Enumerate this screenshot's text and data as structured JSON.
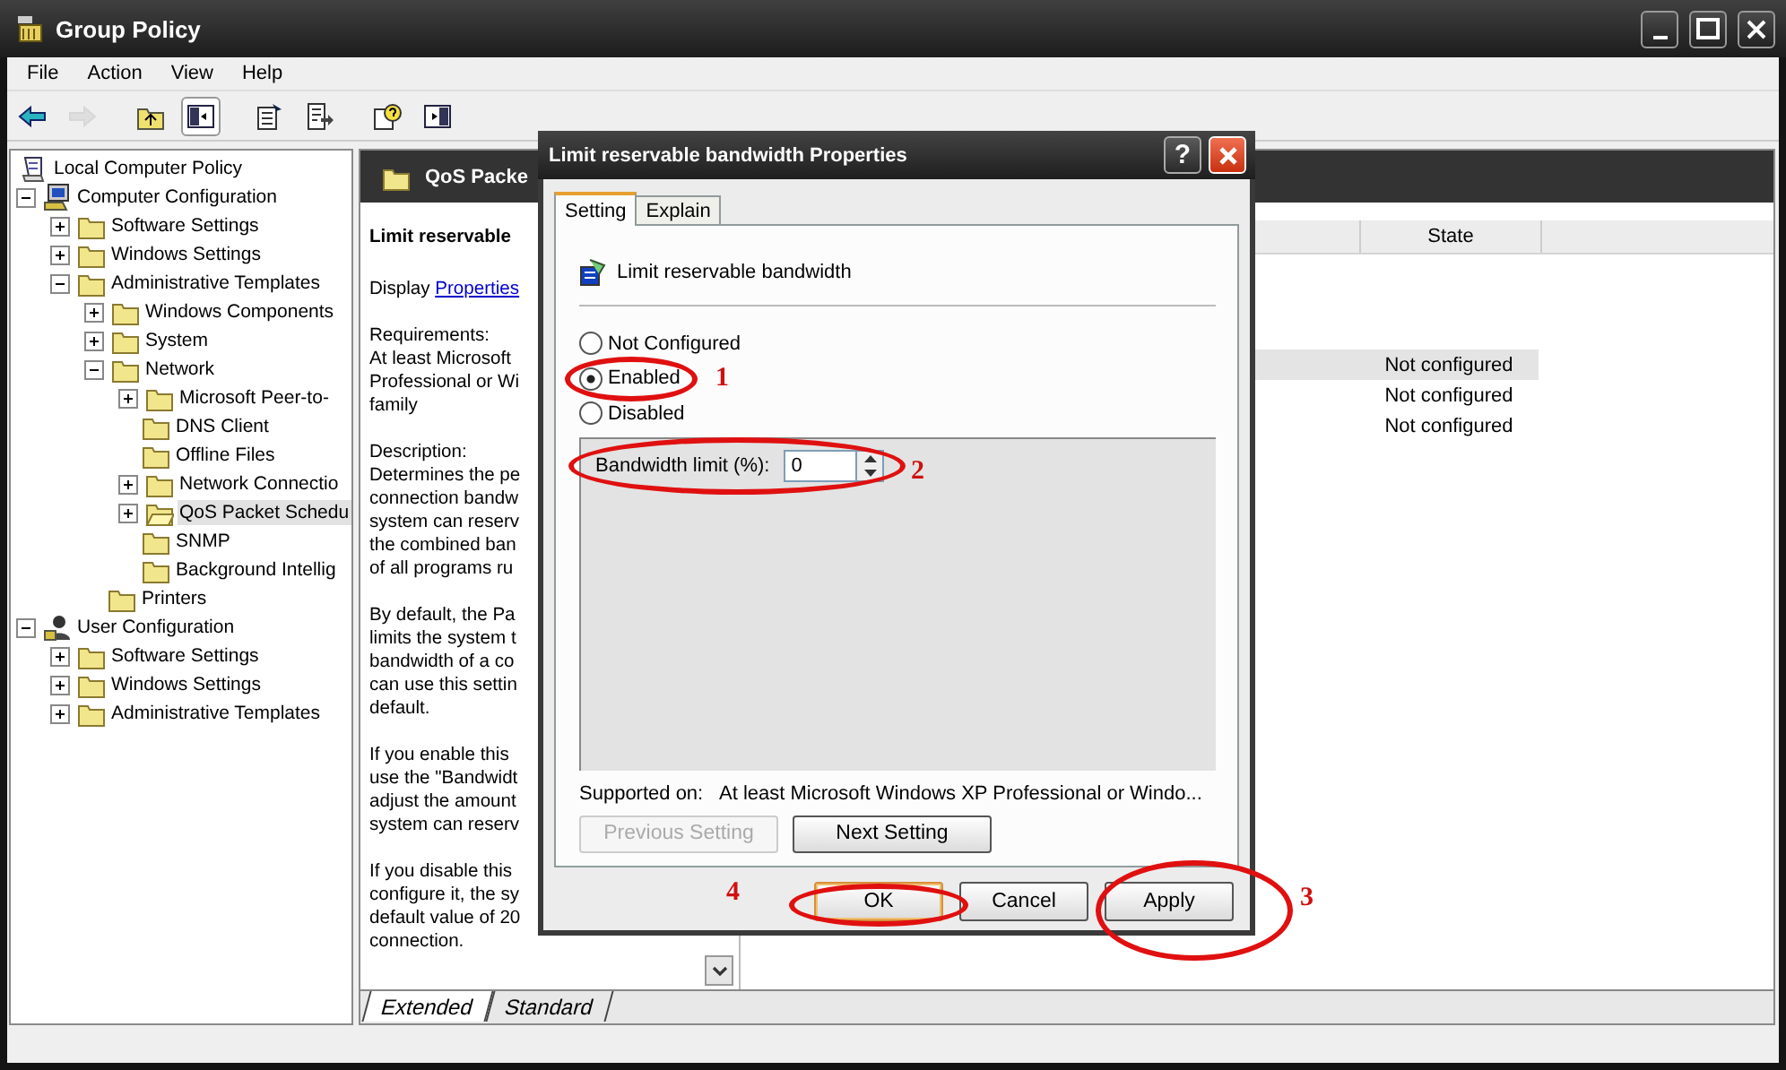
{
  "window": {
    "title": "Group Policy"
  },
  "menu": [
    "File",
    "Action",
    "View",
    "Help"
  ],
  "toolbar": [
    {
      "kind": "back",
      "disabled": false,
      "pressed": false
    },
    {
      "kind": "forward",
      "disabled": true,
      "pressed": false
    },
    {
      "kind": "up",
      "disabled": false,
      "pressed": false
    },
    {
      "kind": "tree",
      "disabled": false,
      "pressed": true
    },
    {
      "kind": "properties",
      "disabled": false,
      "pressed": false
    },
    {
      "kind": "export",
      "disabled": false,
      "pressed": false
    },
    {
      "kind": "help",
      "disabled": false,
      "pressed": false
    },
    {
      "kind": "pane",
      "disabled": false,
      "pressed": false
    }
  ],
  "tree": [
    {
      "label": "Local Computer Policy",
      "kind": "policy",
      "selected": false,
      "children": [
        {
          "label": "Computer Configuration",
          "kind": "computer",
          "expanded": true,
          "selected": false,
          "children": [
            {
              "label": "Software Settings",
              "expanded": false,
              "selected": false
            },
            {
              "label": "Windows Settings",
              "expanded": false,
              "selected": false
            },
            {
              "label": "Administrative Templates",
              "expanded": true,
              "selected": false,
              "children": [
                {
                  "label": "Windows Components",
                  "expanded": false,
                  "selected": false
                },
                {
                  "label": "System",
                  "expanded": false,
                  "selected": false
                },
                {
                  "label": "Network",
                  "expanded": true,
                  "selected": false,
                  "children": [
                    {
                      "label": "Microsoft Peer-to-",
                      "expanded": false,
                      "selected": false
                    },
                    {
                      "label": "DNS Client",
                      "selected": false
                    },
                    {
                      "label": "Offline Files",
                      "selected": false
                    },
                    {
                      "label": "Network Connectio",
                      "expanded": false,
                      "selected": false
                    },
                    {
                      "label": "QoS Packet Schedu",
                      "expanded": false,
                      "selected": true
                    },
                    {
                      "label": "SNMP",
                      "selected": false
                    },
                    {
                      "label": "Background Intellig",
                      "selected": false
                    }
                  ]
                },
                {
                  "label": "Printers",
                  "selected": false
                }
              ]
            }
          ]
        },
        {
          "label": "User Configuration",
          "kind": "user",
          "expanded": true,
          "selected": false,
          "children": [
            {
              "label": "Software Settings",
              "expanded": false,
              "selected": false
            },
            {
              "label": "Windows Settings",
              "expanded": false,
              "selected": false
            },
            {
              "label": "Administrative Templates",
              "expanded": false,
              "selected": false
            }
          ]
        }
      ]
    }
  ],
  "details": {
    "header": "QoS Packe",
    "title": "Limit reservable",
    "display_label": "Display",
    "display_link": "Properties",
    "paragraphs": [
      [
        "Requirements:",
        "At least Microsoft",
        "Professional or Wi",
        "family"
      ],
      [
        "Description:",
        "Determines the pe",
        "connection bandw",
        "system can reserv",
        "the combined ban",
        "of all programs ru"
      ],
      [
        "By default, the Pa",
        "limits the system t",
        "bandwidth of a co",
        "can use this settin",
        "default."
      ],
      [
        "If you enable this",
        "use the \"Bandwidt",
        "adjust the amount",
        "system can reserv"
      ],
      [
        "If you disable this",
        "configure it, the sy",
        "default value of 20",
        "connection."
      ]
    ]
  },
  "list": {
    "columns": [
      {
        "label": "State"
      }
    ],
    "rows": [
      {
        "state": "Not configured",
        "selected": true
      },
      {
        "state": "Not configured",
        "selected": false
      },
      {
        "state": "Not configured",
        "selected": false
      }
    ]
  },
  "view_tabs": [
    {
      "label": "Extended",
      "selected": true
    },
    {
      "label": "Standard",
      "selected": false
    }
  ],
  "dialog": {
    "title": "Limit reservable bandwidth Properties",
    "help": "?",
    "tabs": [
      {
        "label": "Setting",
        "selected": true
      },
      {
        "label": "Explain",
        "selected": false
      }
    ],
    "setting_name": "Limit reservable bandwidth",
    "options": [
      {
        "label": "Not Configured",
        "selected": false
      },
      {
        "label": "Enabled",
        "selected": true
      },
      {
        "label": "Disabled",
        "selected": false
      }
    ],
    "bandwidth": {
      "label": "Bandwidth limit (%):",
      "value": "0"
    },
    "supported_label": "Supported on:",
    "supported_text": "At least Microsoft Windows XP Professional or Windo...",
    "nav_buttons": [
      {
        "label": "Previous Setting",
        "disabled": true
      },
      {
        "label": "Next Setting",
        "disabled": false
      }
    ],
    "buttons": [
      {
        "label": "OK",
        "focused": true
      },
      {
        "label": "Cancel",
        "focused": false
      },
      {
        "label": "Apply",
        "focused": false
      }
    ]
  },
  "annotations": [
    {
      "number": "1"
    },
    {
      "number": "2"
    },
    {
      "number": "3"
    },
    {
      "number": "4"
    }
  ]
}
